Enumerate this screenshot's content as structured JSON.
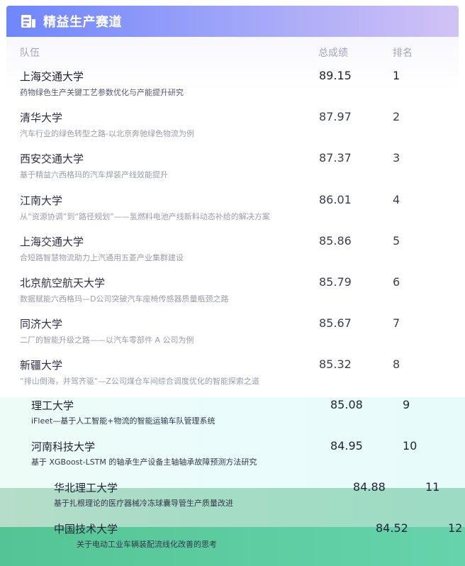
{
  "header": {
    "title": "精益生产赛道",
    "icon": "document-icon",
    "gradient_start": "#6f86ff",
    "gradient_end": "#d2c2f6"
  },
  "columns": {
    "team": "队伍",
    "score": "总成绩",
    "rank": "排名"
  },
  "rows": [
    {
      "team": "上海交通大学",
      "project": "药物绿色生产关键工艺参数优化与产能提升研究",
      "score": "89.15",
      "rank": "1"
    },
    {
      "team": "清华大学",
      "project": "汽车行业的绿色转型之路-以北京奔驰绿色物流为例",
      "score": "87.97",
      "rank": "2"
    },
    {
      "team": "西安交通大学",
      "project": "基于精益六西格玛的汽车焊装产线效能提升",
      "score": "87.37",
      "rank": "3"
    },
    {
      "team": "江南大学",
      "project": "从“资源协调”到“路径规划”——氢燃料电池产线新料动态补给的解决方案",
      "score": "86.01",
      "rank": "4"
    },
    {
      "team": "上海交通大学",
      "project": "合短路智慧物流助力上汽通用五菱产业集群建设",
      "score": "85.86",
      "rank": "5"
    },
    {
      "team": "北京航空航天大学",
      "project": "数据赋能六西格玛—D公司突破汽车座椅传感器质量瓶颈之路",
      "score": "85.79",
      "rank": "6"
    },
    {
      "team": "同济大学",
      "project": "二厂的智能升级之路——以汽车零部件 A 公司为例",
      "score": "85.67",
      "rank": "7"
    },
    {
      "team": "新疆大学",
      "project": "“排山倒海，并驾齐驱”—Z公司煤仓车间综合调度优化的智能探索之道",
      "score": "85.32",
      "rank": "8"
    },
    {
      "team": "理工大学",
      "project": "iFleet—基于人工智能+物流的智能运输车队管理系统",
      "score": "85.08",
      "rank": "9"
    },
    {
      "team": "河南科技大学",
      "project": "基于 XGBoost-LSTM 的轴承生产设备主轴轴承故障预测方法研究",
      "score": "84.95",
      "rank": "10"
    },
    {
      "team": "华北理工大学",
      "project": "基于扎根理论的医疗器械冷冻球囊导管生产质量改进",
      "score": "84.88",
      "rank": "11"
    },
    {
      "team": "中国技术大学",
      "project": "关于电动工业车辆装配流线化改善的思考",
      "score": "84.52",
      "rank": "12"
    }
  ]
}
